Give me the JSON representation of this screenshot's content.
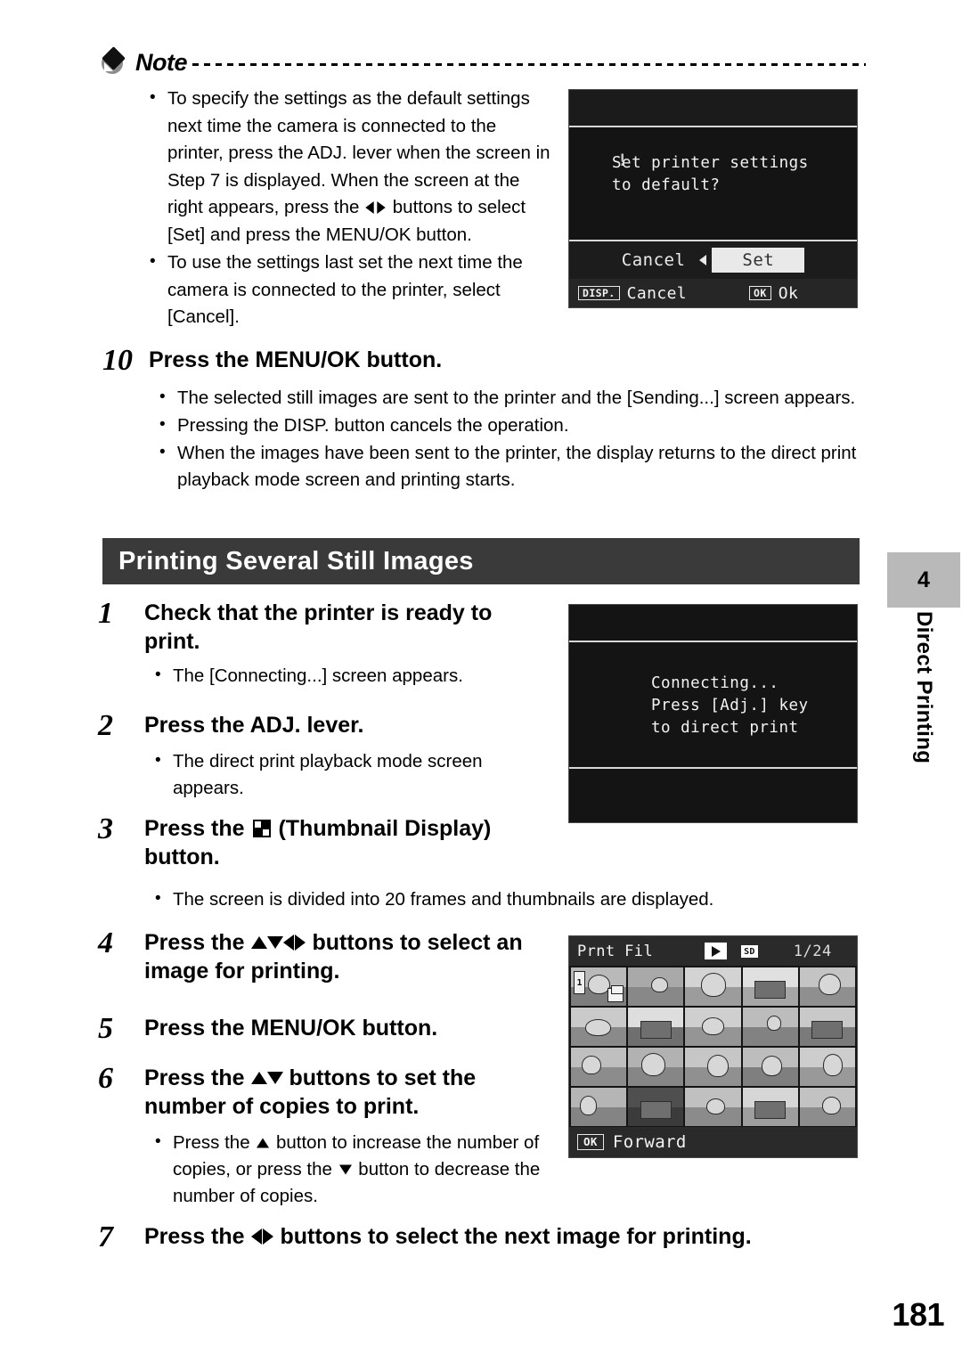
{
  "note": {
    "label": "Note",
    "icon": "note-diamond-icon",
    "bullets": [
      "To specify the settings as the default settings next time the camera is connected to the printer, press the ADJ. lever when the screen in Step 7 is displayed. When the screen at the right appears, press the ◀▶ buttons to select [Set] and press the MENU/OK button.",
      "To use the settings last set the next time the camera is connected to the printer, select [Cancel]."
    ],
    "bullet1_parts": {
      "before_arrows": "To specify the settings as the default settings next time the camera is connected to the printer, press the ADJ. lever when the screen in Step 7 is displayed. When the screen at the right appears, press the ",
      "after_arrows": " buttons to select [Set] and press the MENU/OK button."
    }
  },
  "lcd_default": {
    "warning_icon": "!",
    "message_line1": "Set printer settings",
    "message_line2": "to default?",
    "option_cancel": "Cancel",
    "option_set": "Set",
    "bottom_disp_key": "DISP.",
    "bottom_disp_label": "Cancel",
    "bottom_ok_key": "OK",
    "bottom_ok_label": "Ok"
  },
  "step10": {
    "number": "10",
    "title": "Press the MENU/OK button.",
    "bullets": [
      "The selected still images are sent to the printer and the [Sending...] screen appears.",
      "Pressing the DISP. button cancels the operation.",
      "When the images have been sent to the printer, the display returns to the direct print playback mode screen and printing starts."
    ]
  },
  "section": {
    "title": "Printing Several Still Images"
  },
  "step1": {
    "number": "1",
    "title": "Check that the printer is ready to print.",
    "bullets": [
      "The [Connecting...] screen appears."
    ]
  },
  "lcd_connect": {
    "line1": "Connecting...",
    "line2": "Press [Adj.] key",
    "line3": "to direct print"
  },
  "step2": {
    "number": "2",
    "title": "Press the ADJ. lever.",
    "bullets": [
      "The direct print playback mode screen appears."
    ]
  },
  "step3": {
    "number": "3",
    "title_before": "Press the ",
    "icon": "thumbnail-display-icon",
    "title_after": " (Thumbnail Display) button.",
    "bullets": [
      "The screen is divided into 20 frames and thumbnails are displayed."
    ]
  },
  "step4": {
    "number": "4",
    "title_before": "Press the ",
    "arrows": "▲▼◀▶",
    "title_after": " buttons to select an image for printing."
  },
  "step5": {
    "number": "5",
    "title": "Press the MENU/OK button."
  },
  "step6": {
    "number": "6",
    "title_before": "Press the ",
    "arrows": "▲▼",
    "title_after": " buttons to set the number of copies to print.",
    "bullet_part1": "Press the ",
    "bullet_part2": " button to increase the number of copies, or press the ",
    "bullet_part3": " button to decrease the number of copies."
  },
  "step7": {
    "number": "7",
    "title_before": "Press the ",
    "arrows": "◀▶",
    "title_after": " buttons to select the next image for printing."
  },
  "lcd_thumbs": {
    "title": "Prnt Fil",
    "play_icon": "play-icon",
    "media_icon": "SD",
    "counter": "1/24",
    "selected_index": 0,
    "copies_badge": "1",
    "print_badge_icon": "print-paper-icon",
    "bottom_key": "OK",
    "bottom_label": "Forward",
    "frame_count": 20,
    "columns": 5,
    "rows": 4
  },
  "side_tab": {
    "chapter_number": "4",
    "chapter_title": "Direct Printing",
    "box_color": "#b9b9b9"
  },
  "page_number": "181"
}
